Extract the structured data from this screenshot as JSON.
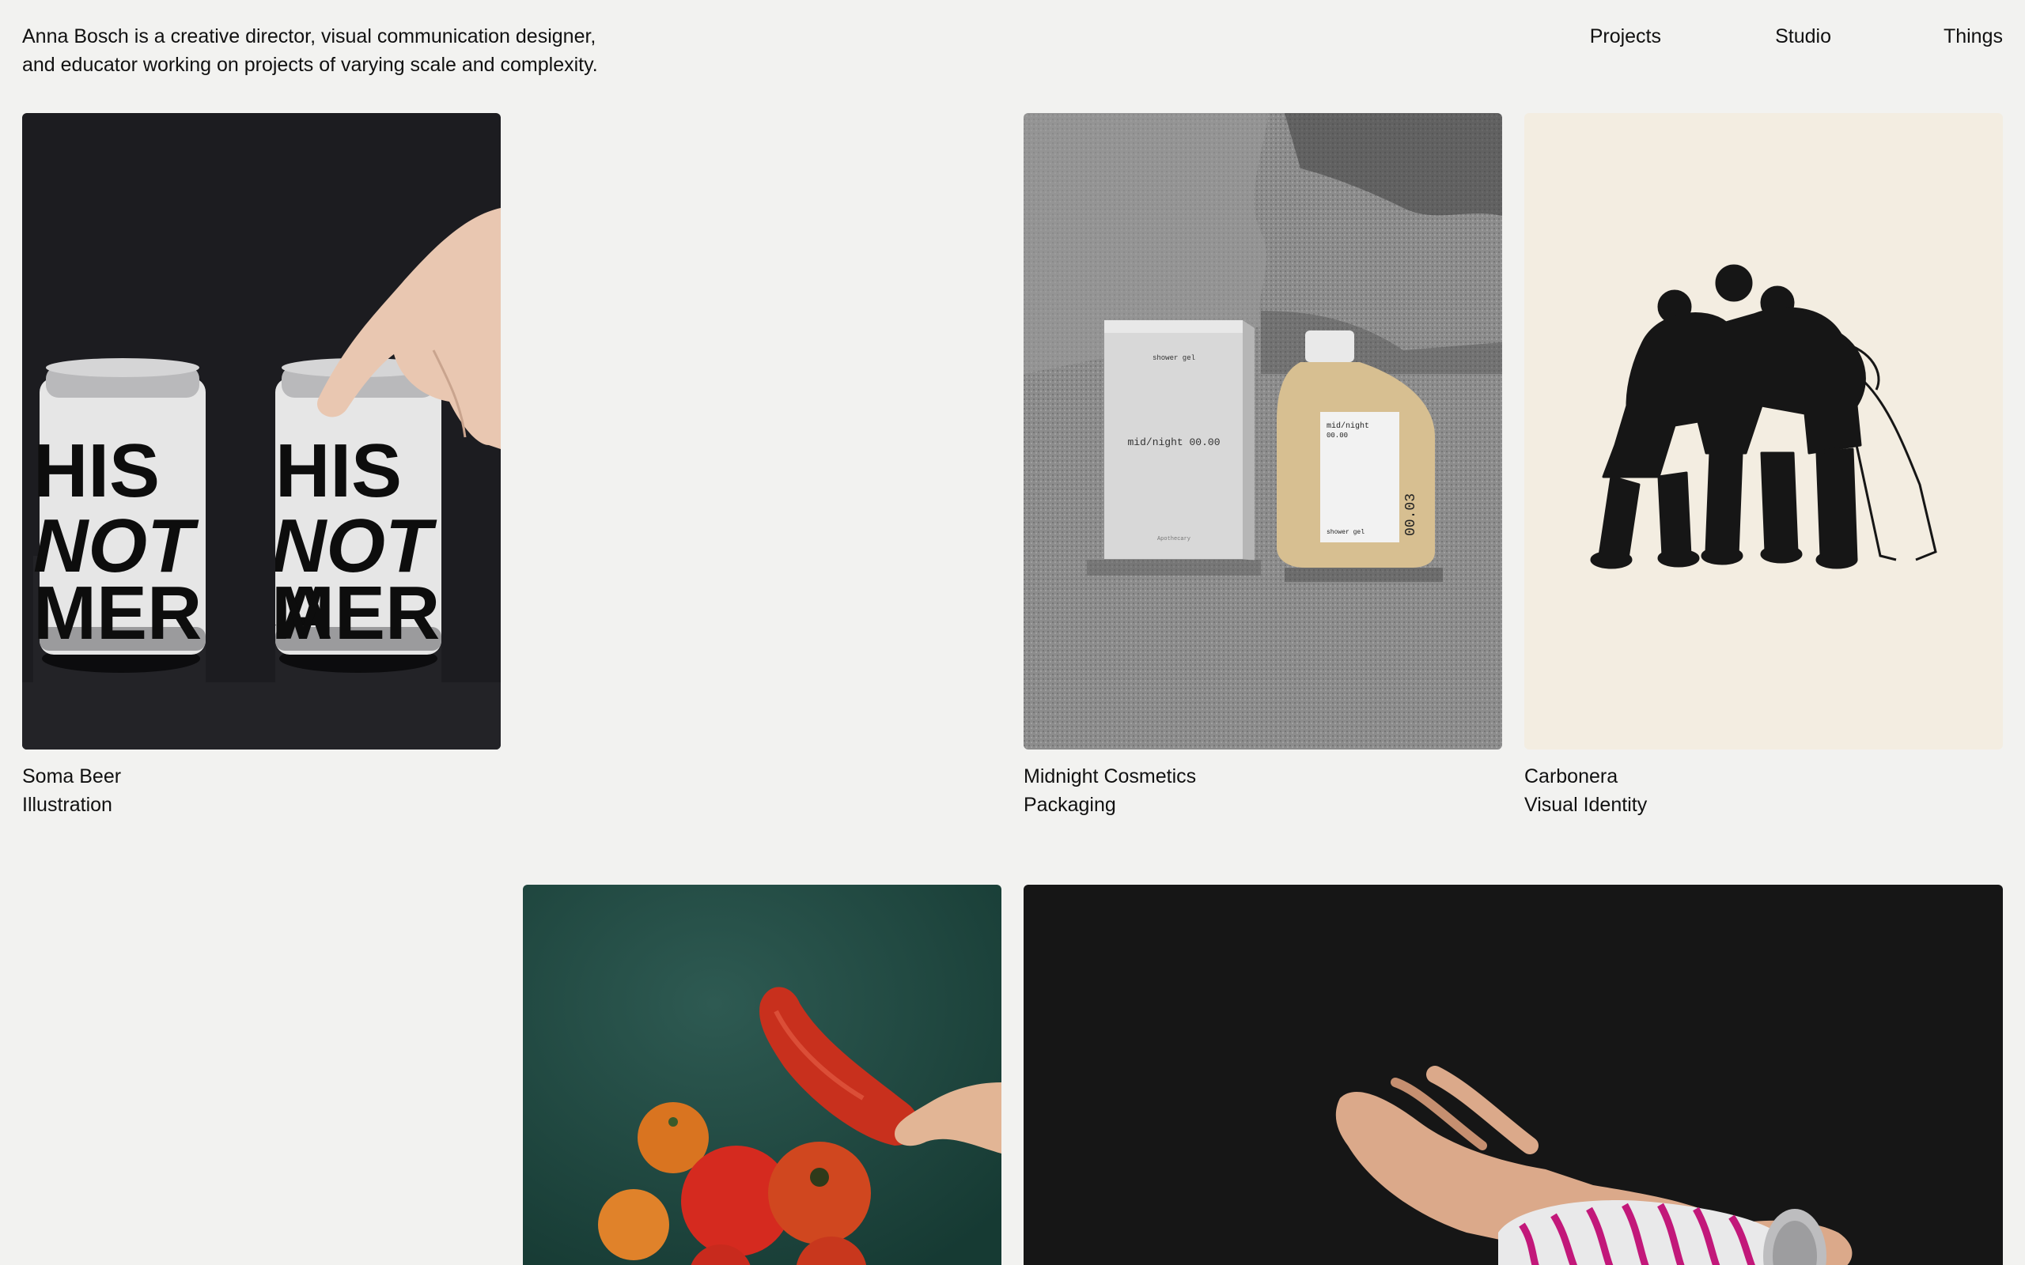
{
  "intro": {
    "line1": "Anna Bosch is a creative director, visual communication designer,",
    "line2": "and educator working on projects of varying scale and complexity."
  },
  "nav": {
    "projects": "Projects",
    "studio": "Studio",
    "things": "Things"
  },
  "projects": [
    {
      "title": "Soma Beer",
      "category": "Illustration",
      "image": {
        "can_text": [
          "HIS",
          "NOT",
          "MERICA"
        ]
      }
    },
    {
      "title": "Midnight Cosmetics",
      "category": "Packaging",
      "image": {
        "box_top": "shower gel",
        "box_label": "mid/night 00.00",
        "box_bottom": "Apothecary",
        "bottle_label": "mid/night",
        "bottle_sub": "00.00",
        "bottle_number": "00.03",
        "bottle_bottom": "shower gel"
      }
    },
    {
      "title": "Carbonera",
      "category": "Visual Identity"
    },
    {
      "title": "",
      "category": ""
    },
    {
      "title": "",
      "category": ""
    }
  ],
  "colors": {
    "background": "#f2f2f0",
    "text": "#111111",
    "soma_bg": "#1c1c20",
    "midnight_bg": "#8a8a8a",
    "carbonera_bg": "#f3ede1",
    "veg_bg": "#1f4a42",
    "can_bg": "#161616"
  }
}
